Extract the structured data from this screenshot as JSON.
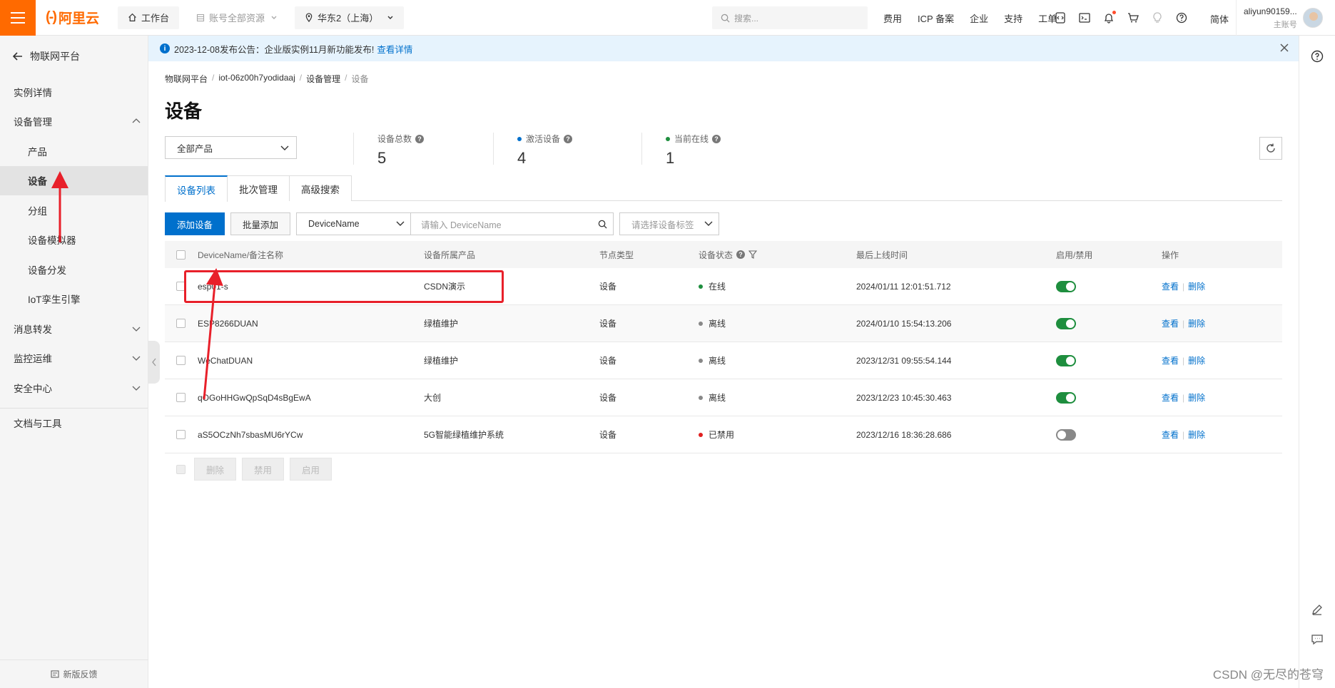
{
  "header": {
    "brand": "阿里云",
    "workbench": "工作台",
    "account_resources": "账号全部资源",
    "region": "华东2（上海）",
    "search_placeholder": "搜索...",
    "links": [
      "费用",
      "ICP 备案",
      "企业",
      "支持",
      "工单"
    ],
    "language": "简体",
    "username": "aliyun90159...",
    "account_type": "主账号"
  },
  "sidebar": {
    "back_label": "物联网平台",
    "items": [
      {
        "label": "实例详情"
      },
      {
        "label": "设备管理"
      },
      {
        "label": "产品"
      },
      {
        "label": "设备"
      },
      {
        "label": "分组"
      },
      {
        "label": "设备模拟器"
      },
      {
        "label": "设备分发"
      },
      {
        "label": "IoT孪生引擎"
      },
      {
        "label": "消息转发"
      },
      {
        "label": "监控运维"
      },
      {
        "label": "安全中心"
      },
      {
        "label": "文档与工具"
      }
    ],
    "feedback": "新版反馈"
  },
  "notice": {
    "text": "2023-12-08发布公告：企业版实例11月新功能发布!",
    "link": "查看详情"
  },
  "breadcrumb": [
    "物联网平台",
    "iot-06z00h7yodidaaj",
    "设备管理",
    "设备"
  ],
  "page_title": "设备",
  "product_filter": "全部产品",
  "stats": [
    {
      "label": "设备总数",
      "value": "5"
    },
    {
      "label": "激活设备",
      "value": "4",
      "dot_color": "#0070cc"
    },
    {
      "label": "当前在线",
      "value": "1",
      "dot_color": "#1e8e3e"
    }
  ],
  "tabs": [
    "设备列表",
    "批次管理",
    "高级搜索"
  ],
  "toolbar": {
    "add_device": "添加设备",
    "batch_add": "批量添加",
    "search_field": "DeviceName",
    "search_placeholder": "请输入 DeviceName",
    "tag_placeholder": "请选择设备标签"
  },
  "table": {
    "headers": [
      "DeviceName/备注名称",
      "设备所属产品",
      "节点类型",
      "设备状态",
      "最后上线时间",
      "启用/禁用",
      "操作"
    ],
    "rows": [
      {
        "name": "esp01-s",
        "product": "CSDN演示",
        "node": "设备",
        "status": "在线",
        "status_color": "#1e8e3e",
        "last_online": "2024/01/11 12:01:51.712",
        "enabled": true,
        "view": "查看",
        "delete": "删除"
      },
      {
        "name": "ESP8266DUAN",
        "product": "绿植维护",
        "node": "设备",
        "status": "离线",
        "status_color": "#888888",
        "last_online": "2024/01/10 15:54:13.206",
        "enabled": true,
        "view": "查看",
        "delete": "删除"
      },
      {
        "name": "WeChatDUAN",
        "product": "绿植维护",
        "node": "设备",
        "status": "离线",
        "status_color": "#888888",
        "last_online": "2023/12/31 09:55:54.144",
        "enabled": true,
        "view": "查看",
        "delete": "删除"
      },
      {
        "name": "qOGoHHGwQpSqD4sBgEwA",
        "product": "大创",
        "node": "设备",
        "status": "离线",
        "status_color": "#888888",
        "last_online": "2023/12/23 10:45:30.463",
        "enabled": true,
        "view": "查看",
        "delete": "删除"
      },
      {
        "name": "aS5OCzNh7sbasMU6rYCw",
        "product": "5G智能绿植维护系统",
        "node": "设备",
        "status": "已禁用",
        "status_color": "#e02020",
        "last_online": "2023/12/16 18:36:28.686",
        "enabled": false,
        "view": "查看",
        "delete": "删除"
      }
    ]
  },
  "bulk_actions": [
    "删除",
    "禁用",
    "启用"
  ],
  "watermark": "CSDN @无尽的苍穹",
  "colors": {
    "brand": "#ff6a00",
    "primary": "#0070cc",
    "annotation": "#e8202a"
  }
}
